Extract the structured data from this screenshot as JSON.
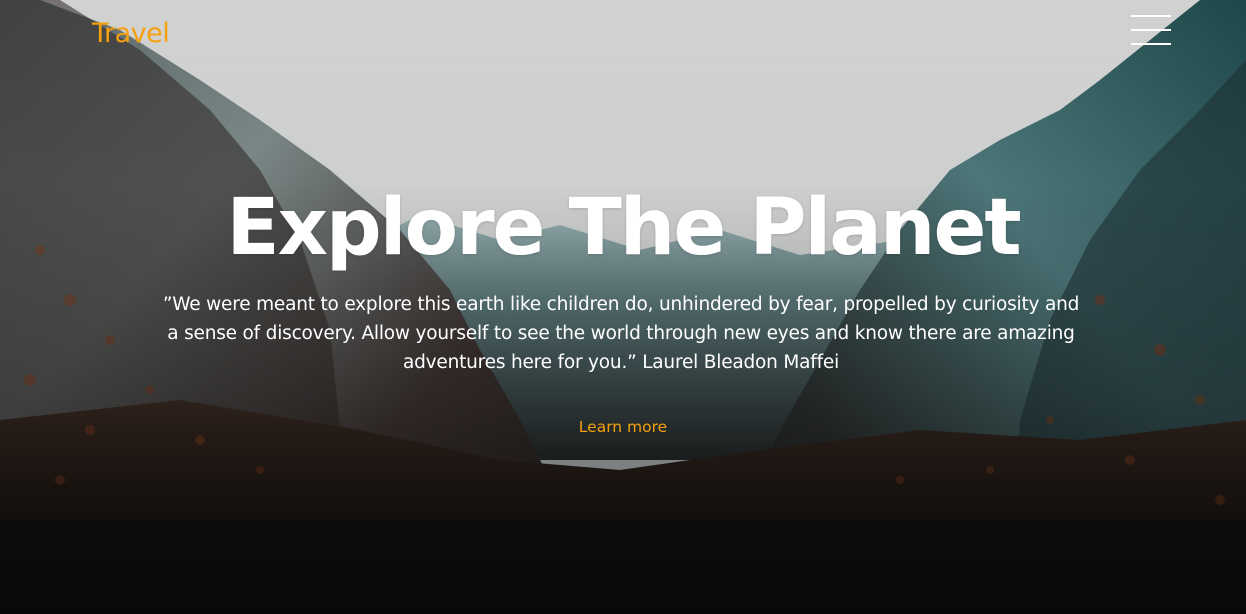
{
  "header": {
    "logo_text": "Travel",
    "menu_icon": "hamburger-menu-icon"
  },
  "hero": {
    "title": "Explore The Planet",
    "quote": "”We were meant to explore this earth like children do, unhindered by fear, propelled by curiosity and a sense of discovery. Allow yourself to see the world through new eyes and know there are amazing adventures here for you.” Laurel Bleadon Maffei",
    "cta_label": "Learn more"
  },
  "colors": {
    "accent": "#f5a00e",
    "text": "#ffffff"
  }
}
